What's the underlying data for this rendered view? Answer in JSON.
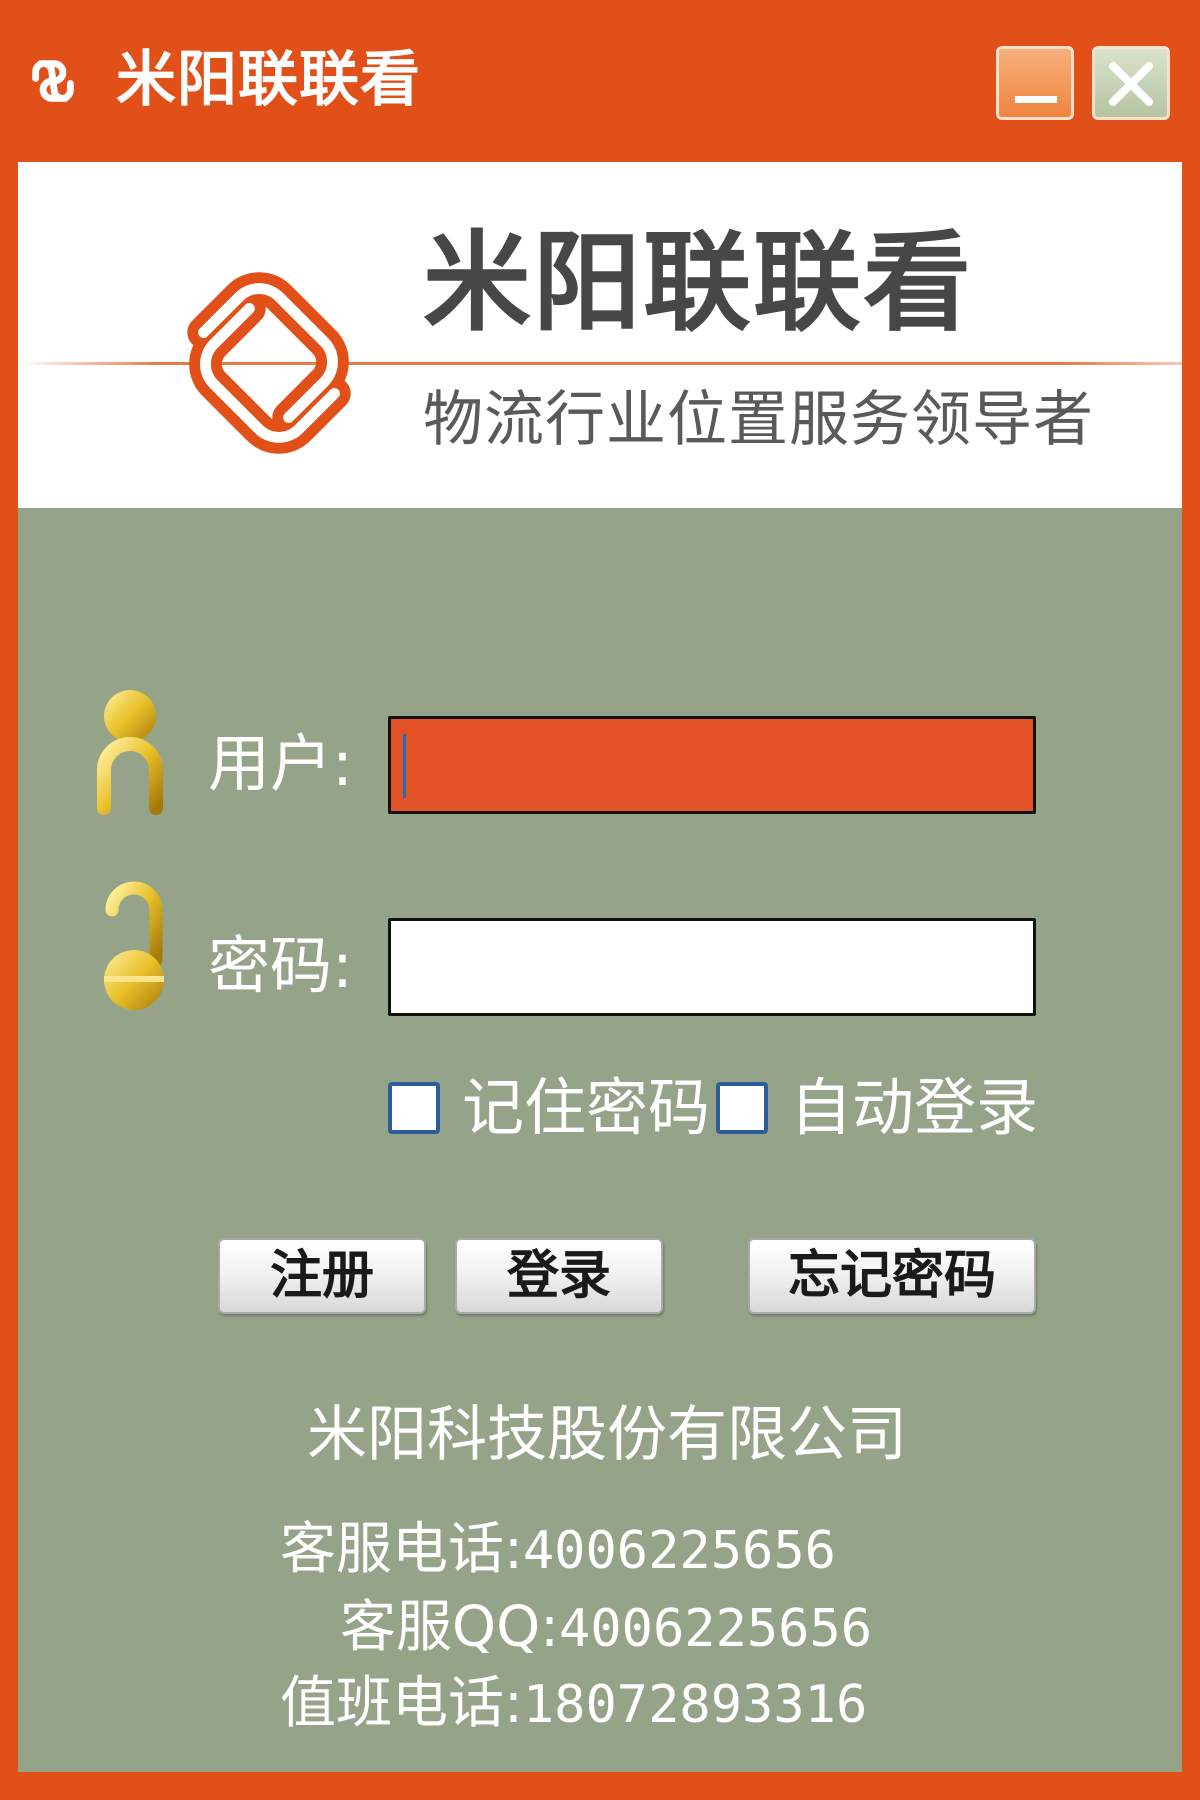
{
  "window": {
    "title": "米阳联联看",
    "minimize_icon": "minimize-icon",
    "close_icon": "close-icon"
  },
  "banner": {
    "title": "米阳联联看",
    "subtitle": "物流行业位置服务领导者",
    "logo_icon": "knot-logo-icon"
  },
  "login": {
    "user_label": "用户:",
    "user_value": "",
    "password_label": "密码:",
    "password_value": "",
    "user_icon": "user-icon",
    "lock_icon": "lock-icon",
    "remember_password": {
      "label": "记住密码",
      "checked": false
    },
    "auto_login": {
      "label": "自动登录",
      "checked": false
    }
  },
  "buttons": {
    "register": "注册",
    "login": "登录",
    "forgot_password": "忘记密码"
  },
  "footer": {
    "company": "米阳科技股份有限公司",
    "service_phone_label": "客服电话:",
    "service_phone": "4006225656",
    "service_qq_label": "客服QQ:",
    "service_qq": "4006225656",
    "duty_phone_label": "值班电话:",
    "duty_phone": "18072893316"
  },
  "colors": {
    "frame": "#e05018",
    "form_background": "#95a389",
    "active_input": "#e25224",
    "logo": "#e05018",
    "gold_icon": "#e8c02a"
  }
}
